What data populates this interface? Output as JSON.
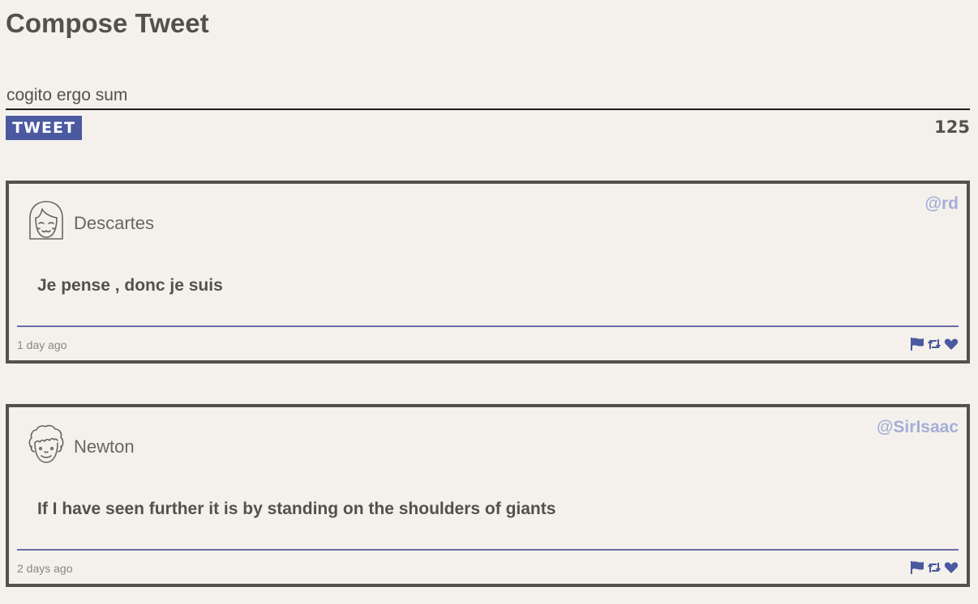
{
  "compose": {
    "title": "Compose Tweet",
    "input_value": "cogito ergo sum",
    "button_label": "TWEET",
    "char_counter": "125"
  },
  "tweets": [
    {
      "name": "Descartes",
      "handle": "@rd",
      "text": "Je pense , donc je suis",
      "timestamp": "1 day ago",
      "avatar_icon": "girl-face-avatar"
    },
    {
      "name": "Newton",
      "handle": "@SirIsaac",
      "text": "If I have seen further it is by standing on the shoulders of giants",
      "timestamp": "2 days ago",
      "avatar_icon": "curly-hair-face-avatar"
    }
  ],
  "colors": {
    "background": "#f4f1ec",
    "text": "#545149",
    "accent": "#4a59a0",
    "handle": "#a5aed8",
    "divider": "#6d6aa6"
  },
  "action_icons": [
    "flag-icon",
    "retweet-icon",
    "heart-icon"
  ]
}
